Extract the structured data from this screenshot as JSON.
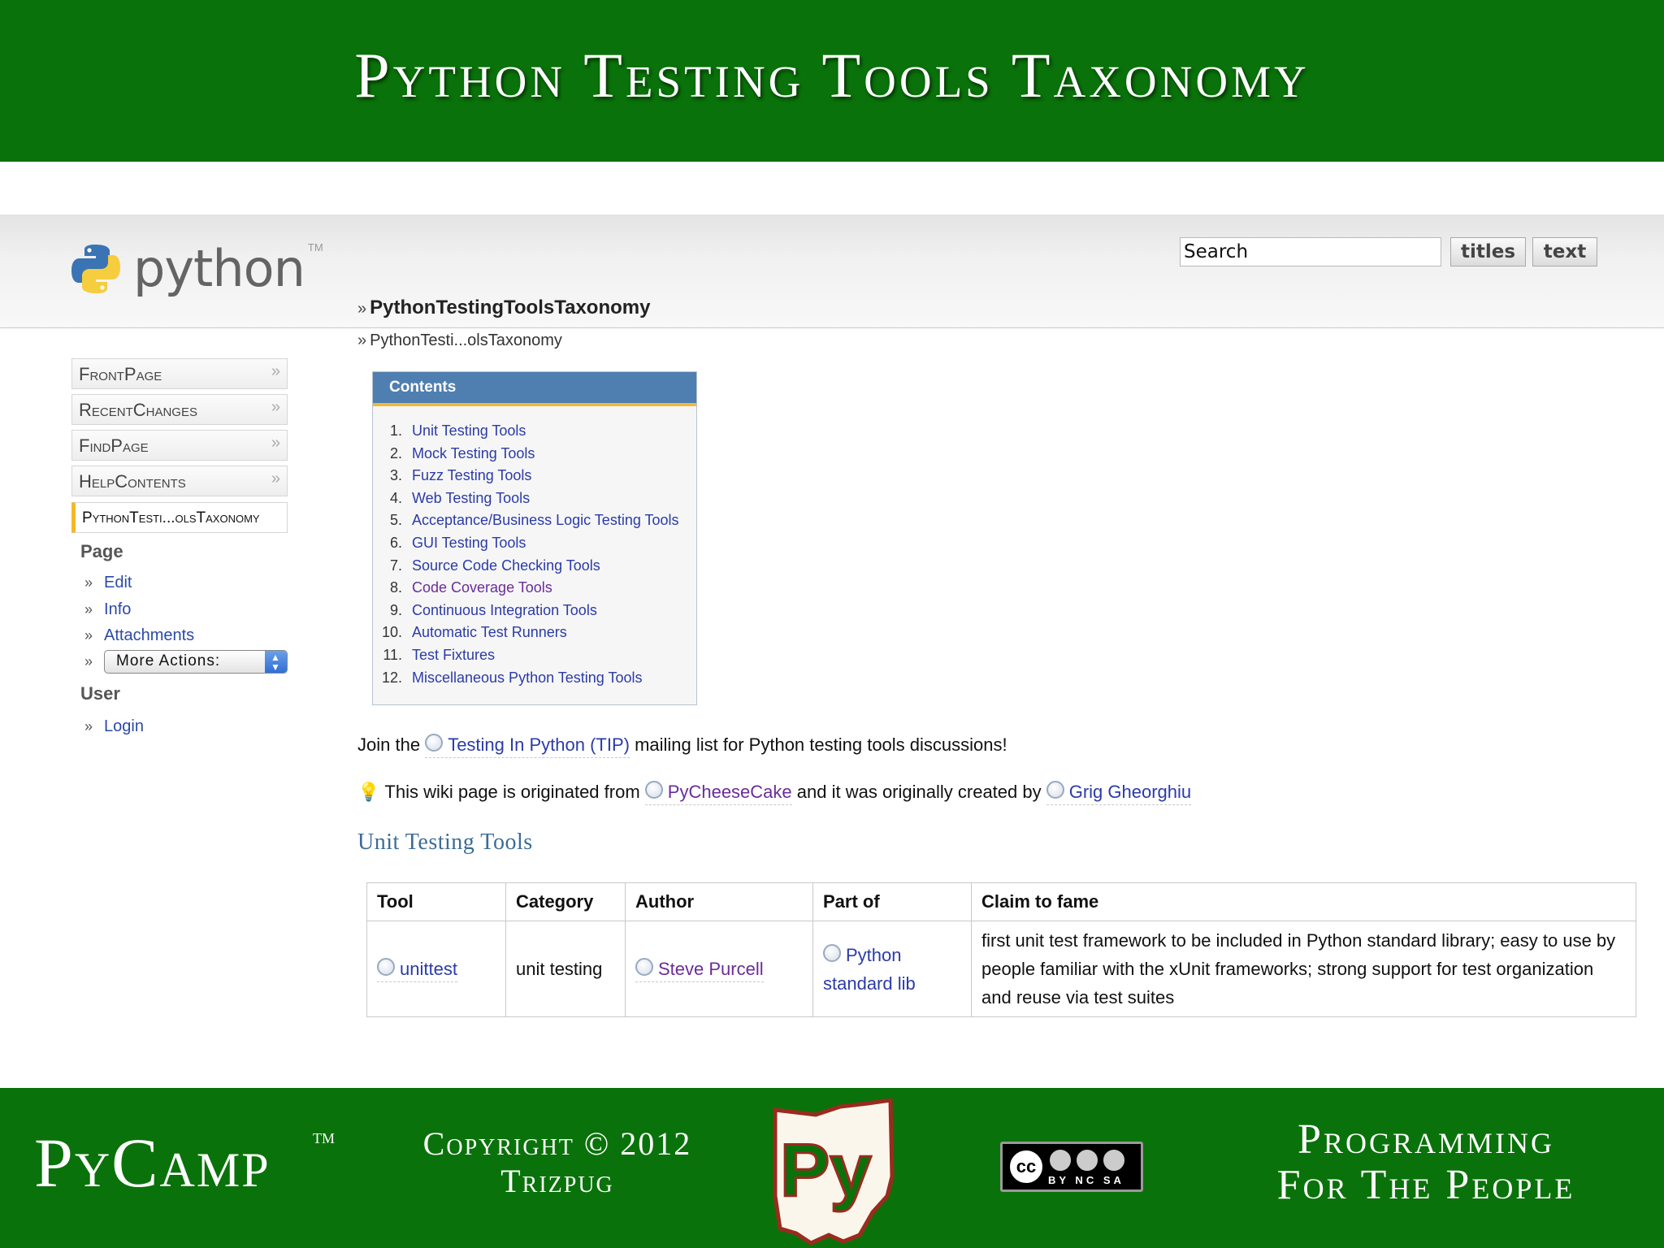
{
  "slide": {
    "title": "Python Testing Tools Taxonomy",
    "footer": {
      "brand": "PyCamp",
      "brand_tm": "TM",
      "copyright_line1": "Copyright © 2012",
      "copyright_line2": "Trizpug",
      "tagline_line1": "Programming",
      "tagline_line2": "For The People",
      "logo_text": "Py",
      "cc_badge": "cc",
      "cc_terms": "BY NC SA"
    }
  },
  "wiki": {
    "logo_text": "python",
    "logo_tm": "TM",
    "search": {
      "value": "Search",
      "titles_button": "titles",
      "text_button": "text"
    },
    "page_link": "PythonTestingToolsTaxonomy",
    "trail": "PythonTesti...olsTaxonomy",
    "nav": [
      {
        "label": "FrontPage"
      },
      {
        "label": "RecentChanges"
      },
      {
        "label": "FindPage"
      },
      {
        "label": "HelpContents"
      },
      {
        "label": "PythonTesti...olsTaxonomy"
      }
    ],
    "page_section": {
      "heading": "Page",
      "items": [
        "Edit",
        "Info",
        "Attachments"
      ],
      "more_actions": "More Actions:"
    },
    "user_section": {
      "heading": "User",
      "items": [
        "Login"
      ]
    },
    "contents": {
      "heading": "Contents",
      "items": [
        {
          "num": "1.",
          "label": "Unit Testing Tools"
        },
        {
          "num": "2.",
          "label": "Mock Testing Tools"
        },
        {
          "num": "3.",
          "label": "Fuzz Testing Tools"
        },
        {
          "num": "4.",
          "label": "Web Testing Tools"
        },
        {
          "num": "5.",
          "label": "Acceptance/Business Logic Testing Tools"
        },
        {
          "num": "6.",
          "label": "GUI Testing Tools"
        },
        {
          "num": "7.",
          "label": "Source Code Checking Tools"
        },
        {
          "num": "8.",
          "label": "Code Coverage Tools"
        },
        {
          "num": "9.",
          "label": "Continuous Integration Tools"
        },
        {
          "num": "10.",
          "label": "Automatic Test Runners"
        },
        {
          "num": "11.",
          "label": "Test Fixtures"
        },
        {
          "num": "12.",
          "label": "Miscellaneous Python Testing Tools"
        }
      ]
    },
    "join": {
      "prefix": "Join the",
      "link": "Testing In Python (TIP)",
      "suffix": "mailing list for Python testing tools discussions!"
    },
    "origin": {
      "prefix": "This wiki page is originated from",
      "link1": "PyCheeseCake",
      "middle": "and it was originally created by",
      "link2": "Grig Gheorghiu"
    },
    "section_heading": "Unit Testing Tools",
    "table": {
      "headers": [
        "Tool",
        "Category",
        "Author",
        "Part of",
        "Claim to fame"
      ],
      "rows": [
        {
          "tool": "unittest",
          "category": "unit testing",
          "author": "Steve Purcell",
          "part_of_line1": "Python",
          "part_of_line2": "standard lib",
          "claim": "first unit test framework to be included in Python standard library; easy to use by people familiar with the xUnit frameworks; strong support for test organization and reuse via test suites"
        }
      ]
    }
  },
  "colors": {
    "slide_green": "#0a720a",
    "link_blue": "#2b3ba8",
    "visited_purple": "#6a2c9a",
    "toc_header": "#4f7fb0"
  }
}
